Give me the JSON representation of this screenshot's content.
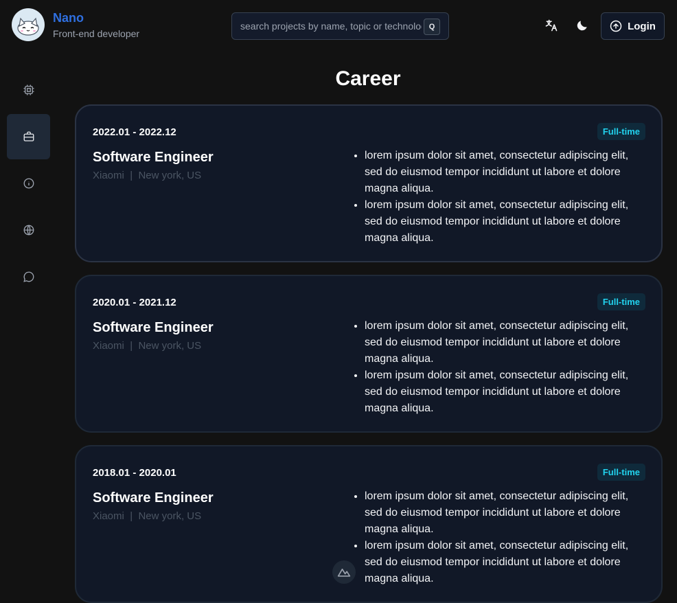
{
  "profile": {
    "name": "Nano",
    "subtitle": "Front-end developer"
  },
  "search": {
    "placeholder": "search projects by name, topic or technology",
    "shortcut_key": "Q"
  },
  "header": {
    "translate_icon": "translate-icon",
    "theme_icon": "moon-icon",
    "login_label": "Login"
  },
  "sidebar": {
    "items": [
      {
        "icon": "cpu-icon",
        "active": false
      },
      {
        "icon": "briefcase-icon",
        "active": true
      },
      {
        "icon": "info-icon",
        "active": false
      },
      {
        "icon": "globe-icon",
        "active": false
      },
      {
        "icon": "chat-icon",
        "active": false
      }
    ]
  },
  "page": {
    "title": "Career"
  },
  "careers": [
    {
      "period": "2022.01 - 2022.12",
      "type": "Full-time",
      "role": "Software Engineer",
      "company": "Xiaomi",
      "location": "New york, US",
      "bullets": [
        "lorem ipsum dolor sit amet, consectetur adipiscing elit, sed do eiusmod tempor incididunt ut labore et dolore magna aliqua.",
        "lorem ipsum dolor sit amet, consectetur adipiscing elit, sed do eiusmod tempor incididunt ut labore et dolore magna aliqua."
      ]
    },
    {
      "period": "2020.01 - 2021.12",
      "type": "Full-time",
      "role": "Software Engineer",
      "company": "Xiaomi",
      "location": "New york, US",
      "bullets": [
        "lorem ipsum dolor sit amet, consectetur adipiscing elit, sed do eiusmod tempor incididunt ut labore et dolore magna aliqua.",
        "lorem ipsum dolor sit amet, consectetur adipiscing elit, sed do eiusmod tempor incididunt ut labore et dolore magna aliqua."
      ]
    },
    {
      "period": "2018.01 - 2020.01",
      "type": "Full-time",
      "role": "Software Engineer",
      "company": "Xiaomi",
      "location": "New york, US",
      "bullets": [
        "lorem ipsum dolor sit amet, consectetur adipiscing elit, sed do eiusmod tempor incididunt ut labore et dolore magna aliqua.",
        "lorem ipsum dolor sit amet, consectetur adipiscing elit, sed do eiusmod tempor incididunt ut labore et dolore magna aliqua."
      ]
    }
  ],
  "meta_separator": "|",
  "colors": {
    "accent": "#2f6fe0",
    "badge_text": "#22d3ee",
    "card_bg": "#111827",
    "page_bg": "#121212"
  }
}
